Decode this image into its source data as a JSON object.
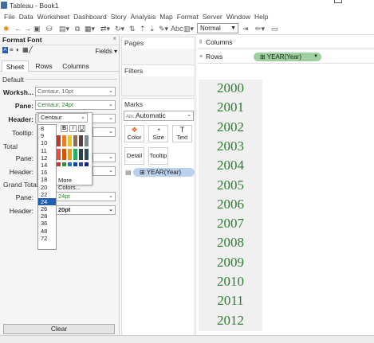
{
  "window": {
    "title": "Tableau - Book1"
  },
  "menu": [
    "File",
    "Data",
    "Worksheet",
    "Dashboard",
    "Story",
    "Analysis",
    "Map",
    "Format",
    "Server",
    "Window",
    "Help"
  ],
  "toolbar": {
    "fit_select": "Normal"
  },
  "format_pane": {
    "title": "Format Font",
    "fields_label": "Fields",
    "tabs": [
      "Sheet",
      "Rows",
      "Columns"
    ],
    "selected_tab": "Sheet",
    "default_label": "Default",
    "worksheet_label": "Worksh...",
    "worksheet_value": "Centaur, 10pt",
    "pane_label": "Pane:",
    "pane_value": "Centaur, 24pt",
    "header_label": "Header:",
    "header_font": "Centaur",
    "tooltip_label": "Tooltip:",
    "total_label": "Total",
    "total_pane_label": "Pane:",
    "total_header_label": "Header:",
    "grand_total_label": "Grand Total",
    "grand_pane_label": "Pane:",
    "grand_pane_value": "24pt",
    "grand_header_label": "Header:",
    "grand_header_value": "20pt",
    "font_size_value": "24",
    "more_colors": "More Colors...",
    "clear_label": "Clear"
  },
  "font_sizes": [
    "8",
    "9",
    "10",
    "11",
    "12",
    "14",
    "16",
    "18",
    "20",
    "22",
    "24",
    "26",
    "28",
    "36",
    "48",
    "72"
  ],
  "selected_size": "24",
  "swatch_colors": {
    "row1": [
      "#c0392b",
      "#e67e22",
      "#f1c40f",
      "#8d6e63",
      "#5d4037",
      "#7f8c8d"
    ],
    "row2": [
      "#e74c3c",
      "#d35400",
      "#f39c12",
      "#27ae60",
      "#2c3e50",
      "#34495e"
    ],
    "row3": [
      "#d32f2f",
      "#388e3c",
      "#1976d2",
      "#0d47a1",
      "#303f9f",
      "#1a237e"
    ]
  },
  "pages": {
    "title": "Pages"
  },
  "filters": {
    "title": "Filters"
  },
  "marks": {
    "title": "Marks",
    "type": "Automatic",
    "color_label": "Color",
    "size_label": "Size",
    "text_label": "Text",
    "detail_label": "Detail",
    "tooltip_label": "Tooltip",
    "pill": "YEAR(Year)"
  },
  "shelves": {
    "columns_label": "Columns",
    "rows_label": "Rows",
    "rows_pill": "YEAR(Year)"
  },
  "years": [
    "2000",
    "2001",
    "2002",
    "2003",
    "2004",
    "2005",
    "2006",
    "2007",
    "2008",
    "2009",
    "2010",
    "2011",
    "2012"
  ]
}
